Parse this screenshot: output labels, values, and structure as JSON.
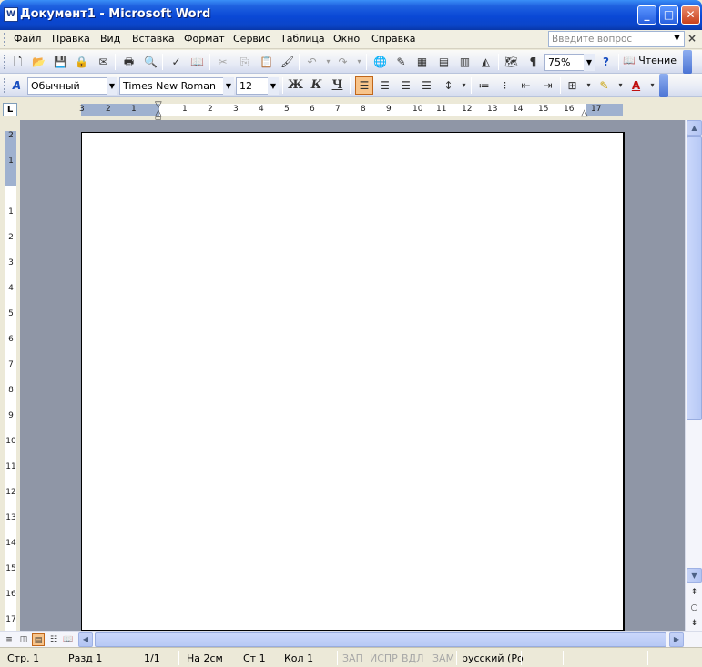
{
  "window": {
    "title": "Документ1 - Microsoft Word",
    "app_icon": "W",
    "buttons": {
      "minimize": "_",
      "maximize": "□",
      "close": "✕"
    }
  },
  "menu": {
    "items": [
      "Файл",
      "Правка",
      "Вид",
      "Вставка",
      "Формат",
      "Сервис",
      "Таблица",
      "Окно",
      "Справка"
    ],
    "help_placeholder": "Введите вопрос"
  },
  "standard_toolbar": {
    "zoom": "75%",
    "reading_label": "Чтение",
    "icons": [
      "new-icon",
      "open-icon",
      "save-icon",
      "permission-icon",
      "email-icon",
      "print-icon",
      "print-preview-icon",
      "spelling-icon",
      "research-icon",
      "cut-icon",
      "copy-icon",
      "paste-icon",
      "format-painter-icon",
      "undo-icon",
      "redo-icon",
      "hyperlink-icon",
      "tables-borders-icon",
      "insert-table-icon",
      "insert-excel-icon",
      "columns-icon",
      "drawing-icon",
      "document-map-icon",
      "show-formatting-icon",
      "help-icon",
      "reading-icon"
    ]
  },
  "formatting_toolbar": {
    "style": "Обычный",
    "font": "Times New Roman",
    "size": "12",
    "bold": "Ж",
    "italic": "К",
    "underline": "Ч"
  },
  "ruler": {
    "numbers": [
      "3",
      "2",
      "1",
      "1",
      "2",
      "3",
      "4",
      "5",
      "6",
      "7",
      "8",
      "9",
      "10",
      "11",
      "12",
      "13",
      "14",
      "15",
      "16",
      "17"
    ],
    "vertical_numbers": [
      "2",
      "1",
      "1",
      "2",
      "3",
      "4",
      "5",
      "6",
      "7",
      "8",
      "9",
      "10",
      "11",
      "12",
      "13",
      "14",
      "15",
      "16",
      "17"
    ]
  },
  "statusbar": {
    "page": "Стр. 1",
    "section": "Разд 1",
    "pages": "1/1",
    "at": "На 2см",
    "line": "Ст 1",
    "column": "Кол 1",
    "rec": "ЗАП",
    "trk": "ИСПР",
    "ext": "ВДЛ",
    "ovr": "ЗАМ",
    "language": "русский (Ро"
  },
  "colors": {
    "titlebar": "#0a48d6",
    "workspace": "#8f96a6",
    "active_button": "#f8c48a"
  }
}
